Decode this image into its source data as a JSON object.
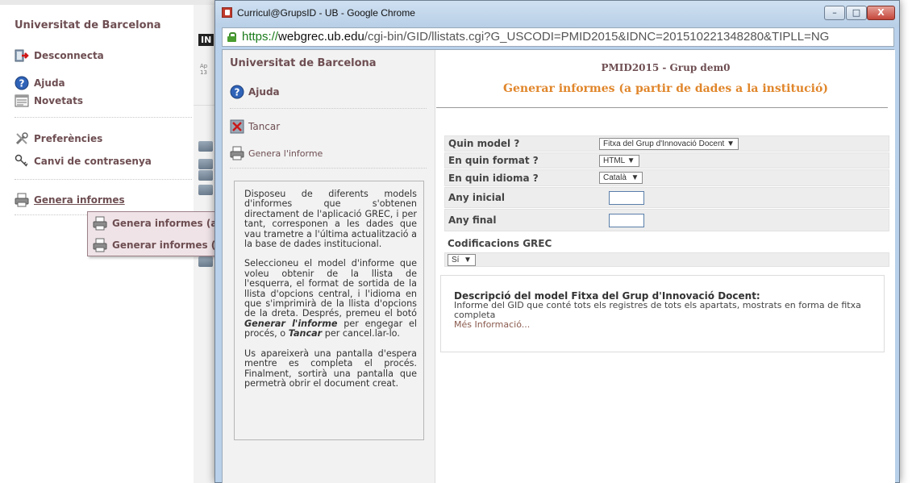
{
  "background": {
    "university": "Universitat de Barcelona",
    "nav": {
      "desconnecta": "Desconnecta",
      "ajuda": "Ajuda",
      "novetats": "Novetats",
      "preferencies": "Preferències",
      "canvi_contrasenya": "Canvi de contrasenya",
      "genera_informes": "Genera informes"
    },
    "in_badge": "IN",
    "ap_text_1": "Ap",
    "ap_text_2": "13",
    "submenu": [
      {
        "label": "Genera informes (a p",
        "icon": "printer-icon"
      },
      {
        "label": "Generar informes (a",
        "icon": "printer-icon"
      }
    ]
  },
  "window": {
    "title": "Curricul@GrupsID - UB - Google Chrome",
    "url_scheme": "https",
    "url_host": "webgrec.ub.edu",
    "url_path": "/cgi-bin/GID/llistats.cgi?G_USCODI=PMID2015&IDNC=201510221348280&TIPLL=NG",
    "buttons": {
      "minimize": "–",
      "maximize": "□",
      "close": "X"
    }
  },
  "left_panel": {
    "university": "Universitat de Barcelona",
    "ajuda": "Ajuda",
    "tancar": "Tancar",
    "genera_informe": "Genera l'informe",
    "info": {
      "p1": "Disposeu de diferents models d'informes que s'obtenen directament de l'aplicació GREC, i per tant, corresponen a les dades que vau trametre a l'última actualització a la base de dades institucional.",
      "p2_a": "Seleccioneu el model d'informe que voleu obtenir de la llista de l'esquerra, el format de sortida de la llista d'opcions central, i l'idioma en que s'imprimirà de la llista d'opcions de la dreta. Després, premeu el botó ",
      "p2_b1": "Generar l'informe",
      "p2_c": " per engegar el procés, o ",
      "p2_b2": "Tancar",
      "p2_d": " per cancel.lar-lo.",
      "p3": "Us apareixerà una pantalla d'espera mentre es completa el procés. Finalment, sortirà una pantalla que permetrà obrir el document creat."
    }
  },
  "right_panel": {
    "group_title": "PMID2015 - Grup dem0",
    "page_title": "Generar informes (a partir de dades a la institució)",
    "form": {
      "model_label": "Quin model ?",
      "model_value": "Fitxa del Grup d'Innovació Docent",
      "format_label": "En quin format ?",
      "format_value": "HTML",
      "idioma_label": "En quin idioma ?",
      "idioma_value": "Català",
      "any_inicial_label": "Any inicial",
      "any_final_label": "Any final",
      "codificacions_label": "Codificacions GREC",
      "codificacions_value": "Sí"
    },
    "description": {
      "title": "Descripció del model Fitxa del Grup d'Innovació Docent:",
      "text": "Informe del GID que conté tots els registres de tots els apartats, mostrats en forma de fitxa completa",
      "link": "Més Informació..."
    }
  },
  "colors": {
    "brand_maroon": "#6e4e52",
    "title_orange": "#e0862b",
    "submenu_bg": "#efe3e7",
    "window_frame": "#b9d1ea"
  }
}
